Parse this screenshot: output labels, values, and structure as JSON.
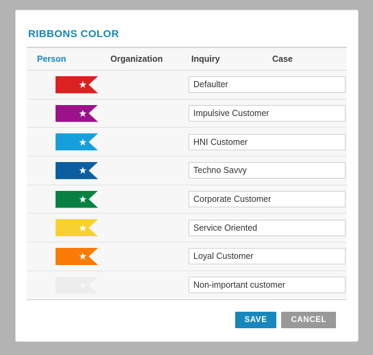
{
  "dialog": {
    "title": "RIBBONS COLOR"
  },
  "columns": [
    {
      "label": "Person",
      "active": true
    },
    {
      "label": "Organization",
      "active": false
    },
    {
      "label": "Inquiry",
      "active": false
    },
    {
      "label": "Case",
      "active": false
    }
  ],
  "ribbons": [
    {
      "color": "#dc2121",
      "star": "★",
      "name": "Defaulter",
      "faded": false
    },
    {
      "color": "#9b128a",
      "star": "★",
      "name": "Impulsive Customer",
      "faded": false
    },
    {
      "color": "#169fdb",
      "star": "★",
      "name": "HNI Customer",
      "faded": false
    },
    {
      "color": "#0b5fa0",
      "star": "★",
      "name": "Techno Savvy",
      "faded": false
    },
    {
      "color": "#068141",
      "star": "★",
      "name": "Corporate Customer",
      "faded": false
    },
    {
      "color": "#f9d12f",
      "star": "★",
      "name": "Service Oriented",
      "faded": false
    },
    {
      "color": "#fa7b05",
      "star": "★",
      "name": "Loyal Customer",
      "faded": false
    },
    {
      "color": "#ededed",
      "star": "★",
      "name": "Non-important customer",
      "faded": true
    }
  ],
  "footer": {
    "save_label": "SAVE",
    "cancel_label": "CANCEL"
  },
  "theme": {
    "accent": "#1787bd",
    "cancel": "#999999",
    "panel_bg": "#ffffff",
    "page_bg": "#b3b3b3",
    "row_bg": "#f7f7f7"
  }
}
